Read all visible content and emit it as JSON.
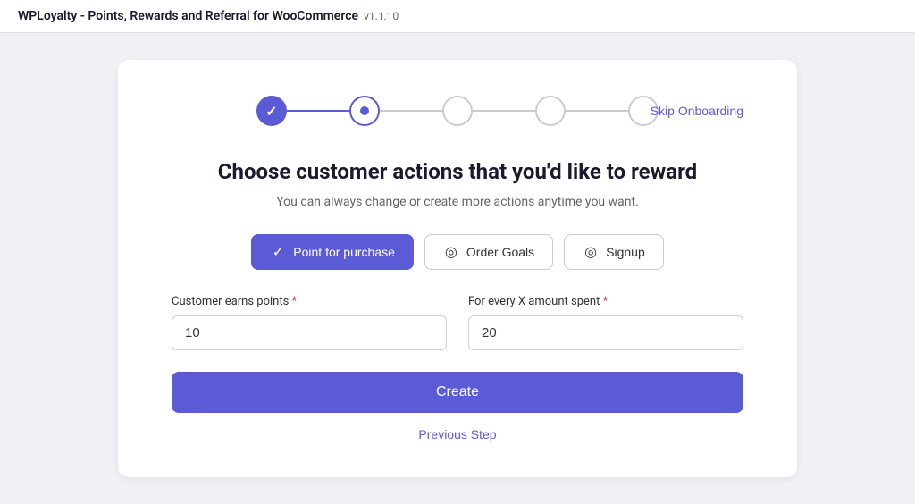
{
  "topbar": {
    "title": "WPLoyalty - Points, Rewards and Referral for WooCommerce",
    "version": "v1.1.10"
  },
  "stepper": {
    "skip_label": "Skip Onboarding",
    "steps": [
      {
        "id": 1,
        "state": "completed"
      },
      {
        "id": 2,
        "state": "active"
      },
      {
        "id": 3,
        "state": "inactive"
      },
      {
        "id": 4,
        "state": "inactive"
      },
      {
        "id": 5,
        "state": "inactive"
      }
    ]
  },
  "heading": "Choose customer actions that you'd like to reward",
  "subheading": "You can always change or create more actions anytime you want.",
  "actions": [
    {
      "id": "purchase",
      "label": "Point for purchase",
      "active": true
    },
    {
      "id": "order_goals",
      "label": "Order Goals",
      "active": false
    },
    {
      "id": "signup",
      "label": "Signup",
      "active": false
    }
  ],
  "form": {
    "field1": {
      "label": "Customer earns points",
      "required": "*",
      "value": "10",
      "placeholder": ""
    },
    "field2": {
      "label": "For every X amount spent",
      "required": "*",
      "value": "20",
      "placeholder": ""
    }
  },
  "create_button": "Create",
  "previous_step": "Previous Step"
}
